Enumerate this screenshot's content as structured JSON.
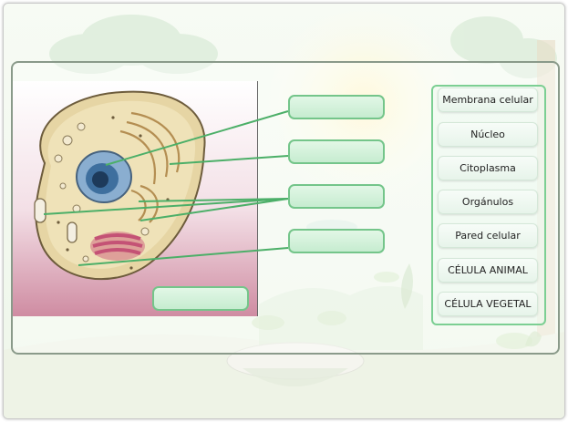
{
  "terms": [
    {
      "label": "Membrana celular"
    },
    {
      "label": "Núcleo"
    },
    {
      "label": "Citoplasma"
    },
    {
      "label": "Orgánulos"
    },
    {
      "label": "Pared celular"
    },
    {
      "label": "CÉLULA ANIMAL"
    },
    {
      "label": "CÉLULA VEGETAL"
    }
  ],
  "colors": {
    "slot_fill": "#c6ecd0",
    "slot_border": "#74c58a",
    "bank_border": "#7ccf93",
    "connector": "#4caf68"
  },
  "icons": [
    "animal-cell-illustration"
  ]
}
